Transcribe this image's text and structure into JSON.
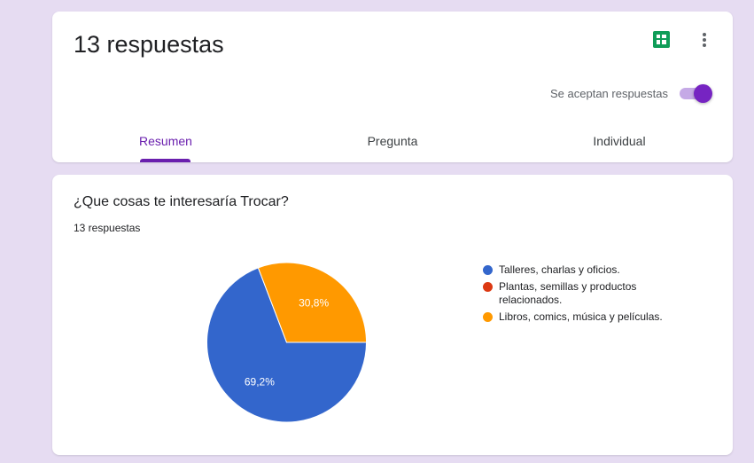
{
  "header": {
    "title": "13 respuestas",
    "sheets_icon": "google-sheets-icon",
    "more_icon": "more-vert-icon",
    "accepting_label": "Se aceptan respuestas",
    "accepting_on": true,
    "tabs": [
      {
        "label": "Resumen",
        "active": true
      },
      {
        "label": "Pregunta",
        "active": false
      },
      {
        "label": "Individual",
        "active": false
      }
    ]
  },
  "question": {
    "title": "¿Que cosas te interesaría Trocar?",
    "count": "13 respuestas"
  },
  "chart_data": {
    "type": "pie",
    "categories": [
      "Talleres, charlas y oficios.",
      "Plantas, semillas y productos relacionados.",
      "Libros, comics, música y películas."
    ],
    "values": [
      69.2,
      0,
      30.8
    ],
    "labels": [
      "69,2%",
      "",
      "30,8%"
    ],
    "colors": [
      "#3366cc",
      "#dc3912",
      "#ff9900"
    ],
    "legend_position": "right"
  },
  "colors": {
    "accent": "#6a1fae",
    "background": "#e6dcf2",
    "sheets_green": "#0f9d58"
  }
}
